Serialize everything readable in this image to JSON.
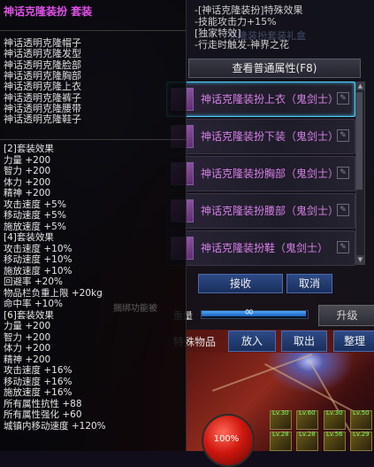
{
  "tooltip": {
    "title": "神话克隆装扮  套装",
    "pieces": [
      "神话透明克隆帽子",
      "神话透明克隆发型",
      "神话透明克隆脸部",
      "神话透明克隆胸部",
      "神话透明克隆上衣",
      "神话透明克隆裤子",
      "神话透明克隆腰带",
      "神话透明克隆鞋子"
    ],
    "set_effects": [
      "[2]套装效果",
      "力量 +200",
      "智力 +200",
      "体力 +200",
      "精神 +200",
      "攻击速度 +5%",
      "移动速度 +5%",
      "施放速度 +5%",
      "[4]套装效果",
      "攻击速度 +10%",
      "移动速度 +10%",
      "施放速度 +10%",
      "回避率 +20%",
      "物品栏负重上限 +20kg",
      "命中率 +10%",
      "[6]套装效果",
      "力量 +200",
      "智力 +200",
      "体力 +200",
      "精神 +200",
      "攻击速度 +16%",
      "移动速度 +16%",
      "施放速度 +16%",
      "所有属性抗性 +88",
      "所有属性强化 +60",
      "城镇内移动速度 +120%"
    ]
  },
  "dialog": {
    "effects": [
      "-[神话克隆装扮]特殊效果",
      "-技能攻击力+15%",
      "[独家特效]",
      "-行走时触发-神界之花"
    ],
    "ghost_title": "克隆装扮套装礼盒",
    "view_attr_label": "查看普通属性(F8)",
    "items": [
      "神话克隆装扮上衣（鬼剑士）",
      "神话克隆装扮下装（鬼剑士）",
      "神话克隆装扮胸部（鬼剑士）",
      "神话克隆装扮腰部（鬼剑士）",
      "神话克隆装扮鞋（鬼剑士）"
    ],
    "accept_label": "接收",
    "cancel_label": "取消"
  },
  "bottom_bar": {
    "weight_label": "重量",
    "upgrade_label": "升级",
    "items_label": "特殊物品",
    "put_in_label": "放入",
    "sell_label": "取出",
    "sort_label": "整理",
    "ghost_text": "捆绑功能被",
    "weight_fill_fraction": 0.98
  },
  "hud": {
    "hp_text": "100%",
    "skill_levels": [
      "Lv.30",
      "Lv.60",
      "Lv.30",
      "Lv.50",
      "Lv.28",
      "Lv.28",
      "Lv.56",
      "Lv.29"
    ]
  },
  "colors": {
    "item_purple": "#d77fe8",
    "title_magenta": "#e050e8",
    "selected_border": "#4fd0ff",
    "button_blue": "#2d4a86"
  }
}
